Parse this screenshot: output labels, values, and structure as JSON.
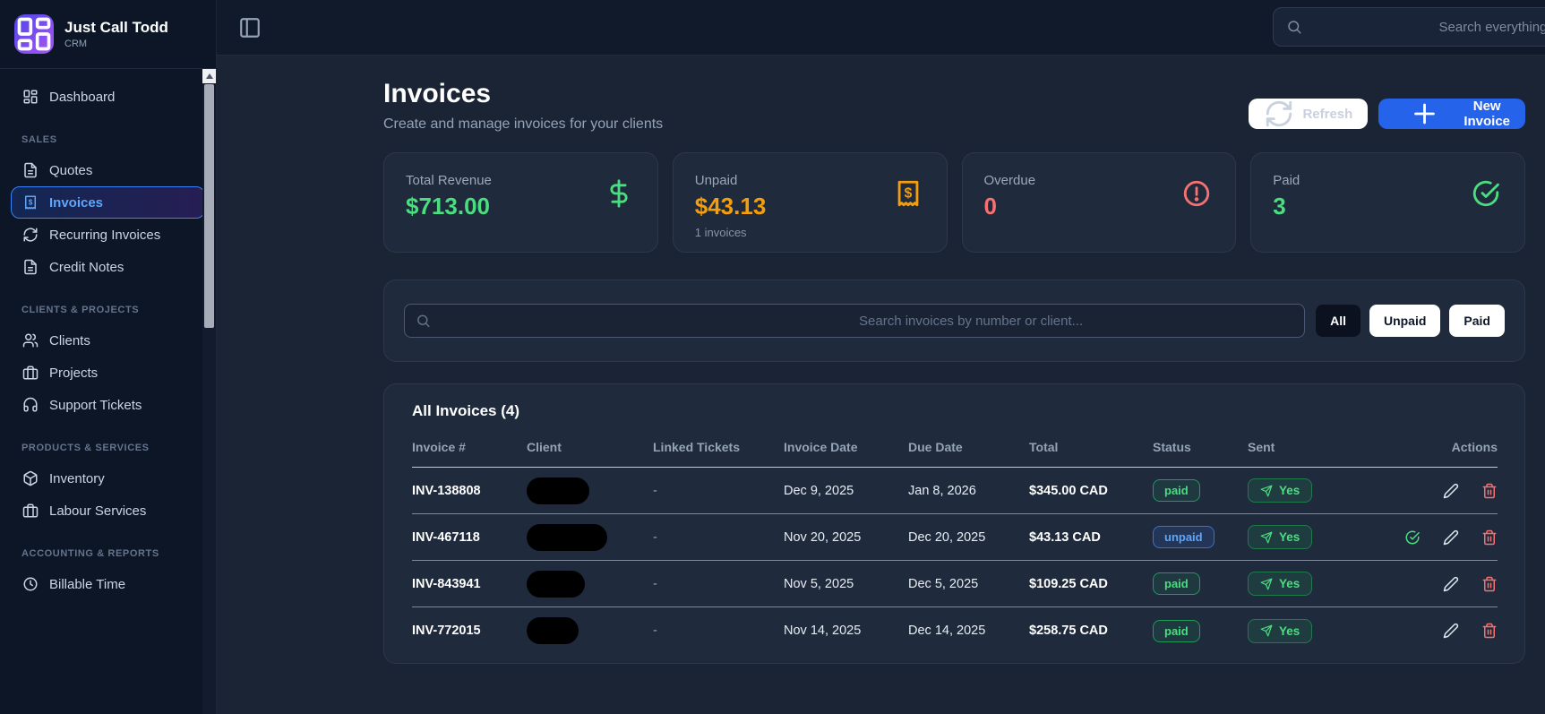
{
  "brand": {
    "name": "Just Call Todd",
    "subtitle": "CRM"
  },
  "topbar": {
    "search_placeholder": "Search everything..."
  },
  "sidebar": {
    "sections": [
      {
        "title": "",
        "items": [
          {
            "label": "Dashboard",
            "icon": "layout-dashboard",
            "active": false
          }
        ]
      },
      {
        "title": "SALES",
        "items": [
          {
            "label": "Quotes",
            "icon": "file-text",
            "active": false
          },
          {
            "label": "Invoices",
            "icon": "receipt-dollar",
            "active": true
          },
          {
            "label": "Recurring Invoices",
            "icon": "refresh",
            "active": false
          },
          {
            "label": "Credit Notes",
            "icon": "file-text",
            "active": false
          }
        ]
      },
      {
        "title": "CLIENTS & PROJECTS",
        "items": [
          {
            "label": "Clients",
            "icon": "users",
            "active": false
          },
          {
            "label": "Projects",
            "icon": "briefcase",
            "active": false
          },
          {
            "label": "Support Tickets",
            "icon": "headphones",
            "active": false
          }
        ]
      },
      {
        "title": "PRODUCTS & SERVICES",
        "items": [
          {
            "label": "Inventory",
            "icon": "package",
            "active": false
          },
          {
            "label": "Labour Services",
            "icon": "briefcase",
            "active": false
          }
        ]
      },
      {
        "title": "ACCOUNTING & REPORTS",
        "items": [
          {
            "label": "Billable Time",
            "icon": "clock",
            "active": false
          }
        ]
      }
    ]
  },
  "page": {
    "title": "Invoices",
    "subtitle": "Create and manage invoices for your clients",
    "refresh_label": "Refresh",
    "new_invoice_label": "New Invoice"
  },
  "stats": [
    {
      "label": "Total Revenue",
      "value": "$713.00",
      "sub": "",
      "color": "#4ade80",
      "icon": "dollar-sign"
    },
    {
      "label": "Unpaid",
      "value": "$43.13",
      "sub": "1 invoices",
      "color": "#f59e0b",
      "icon": "receipt-dollar"
    },
    {
      "label": "Overdue",
      "value": "0",
      "sub": "",
      "color": "#f87171",
      "icon": "alert-circle"
    },
    {
      "label": "Paid",
      "value": "3",
      "sub": "",
      "color": "#4ade80",
      "icon": "check-circle"
    }
  ],
  "filters": {
    "search_placeholder": "Search invoices by number or client...",
    "buttons": [
      {
        "label": "All",
        "active": true
      },
      {
        "label": "Unpaid",
        "active": false
      },
      {
        "label": "Paid",
        "active": false
      }
    ]
  },
  "table": {
    "title": "All Invoices (4)",
    "columns": [
      "Invoice #",
      "Client",
      "Linked Tickets",
      "Invoice Date",
      "Due Date",
      "Total",
      "Status",
      "Sent",
      "Actions"
    ],
    "rows": [
      {
        "invoice": "INV-138808",
        "client_redacted": true,
        "linked_tickets": "-",
        "invoice_date": "Dec 9, 2025",
        "due_date": "Jan 8, 2026",
        "total": "$345.00 CAD",
        "status": "paid",
        "sent": "Yes",
        "actions": [
          "edit",
          "delete"
        ]
      },
      {
        "invoice": "INV-467118",
        "client_redacted": true,
        "linked_tickets": "-",
        "invoice_date": "Nov 20, 2025",
        "due_date": "Dec 20, 2025",
        "total": "$43.13 CAD",
        "status": "unpaid",
        "sent": "Yes",
        "actions": [
          "mark-paid",
          "edit",
          "delete"
        ]
      },
      {
        "invoice": "INV-843941",
        "client_redacted": true,
        "linked_tickets": "-",
        "invoice_date": "Nov 5, 2025",
        "due_date": "Dec 5, 2025",
        "total": "$109.25 CAD",
        "status": "paid",
        "sent": "Yes",
        "actions": [
          "edit",
          "delete"
        ]
      },
      {
        "invoice": "INV-772015",
        "client_redacted": true,
        "linked_tickets": "-",
        "invoice_date": "Nov 14, 2025",
        "due_date": "Dec 14, 2025",
        "total": "$258.75 CAD",
        "status": "paid",
        "sent": "Yes",
        "actions": [
          "edit",
          "delete"
        ]
      }
    ]
  },
  "colors": {
    "accent_blue": "#2563eb",
    "green": "#4ade80",
    "orange": "#f59e0b",
    "red": "#f87171",
    "status_blue": "#60a5fa"
  }
}
